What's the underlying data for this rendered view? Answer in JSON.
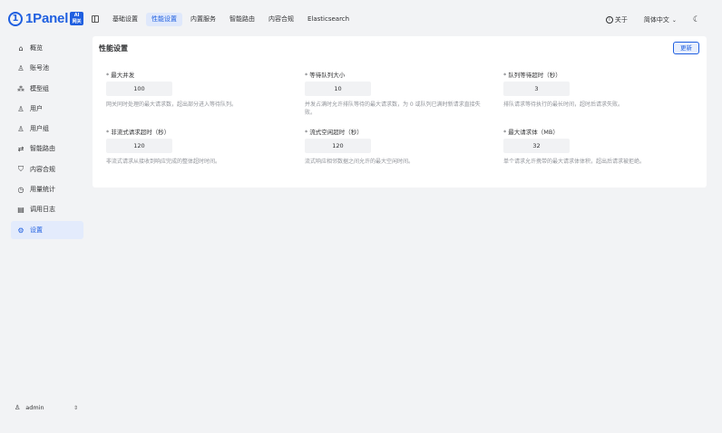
{
  "app": {
    "logo_mark": "1",
    "logo_text": "1Panel",
    "logo_badge_line1": "AI",
    "logo_badge_line2": "网关"
  },
  "topnav": {
    "tabs": [
      {
        "label": "基础设置",
        "active": false
      },
      {
        "label": "性能设置",
        "active": true
      },
      {
        "label": "内置服务",
        "active": false
      },
      {
        "label": "智能路由",
        "active": false
      },
      {
        "label": "内容合规",
        "active": false
      },
      {
        "label": "Elasticsearch",
        "active": false
      }
    ],
    "about_label": "关于",
    "language_label": "简体中文",
    "theme_icon": "moon-icon"
  },
  "sidebar": {
    "items": [
      {
        "label": "概览",
        "icon": "home-icon"
      },
      {
        "label": "账号池",
        "icon": "user-group-icon"
      },
      {
        "label": "模型组",
        "icon": "cluster-icon"
      },
      {
        "label": "用户",
        "icon": "user-icon"
      },
      {
        "label": "用户组",
        "icon": "users-icon"
      },
      {
        "label": "智能路由",
        "icon": "route-icon"
      },
      {
        "label": "内容合规",
        "icon": "shield-icon"
      },
      {
        "label": "用量统计",
        "icon": "clock-icon"
      },
      {
        "label": "调用日志",
        "icon": "log-icon"
      },
      {
        "label": "设置",
        "icon": "gear-icon",
        "active": true
      }
    ],
    "user_name": "admin"
  },
  "main": {
    "title": "性能设置",
    "update_button": "更新",
    "fields": [
      {
        "label": "最大并发",
        "value": "100",
        "help": "网关同时处理的最大请求数，超出部分进入等待队列。"
      },
      {
        "label": "等待队列大小",
        "value": "10",
        "help": "并发占满时允许排队等待的最大请求数，为 0 或队列已满时新请求直接失败。"
      },
      {
        "label": "队列等待超时（秒）",
        "value": "3",
        "help": "排队请求等待执行的最长时间，超时后请求失败。"
      },
      {
        "label": "非流式请求超时（秒）",
        "value": "120",
        "help": "非流式请求从接收到响应完成的整体超时时间。"
      },
      {
        "label": "流式空闲超时（秒）",
        "value": "120",
        "help": "流式响应相邻数据之间允许的最大空闲时间。"
      },
      {
        "label": "最大请求体（MB）",
        "value": "32",
        "help": "单个请求允许携带的最大请求体体积，超出后请求被拒绝。"
      }
    ]
  }
}
